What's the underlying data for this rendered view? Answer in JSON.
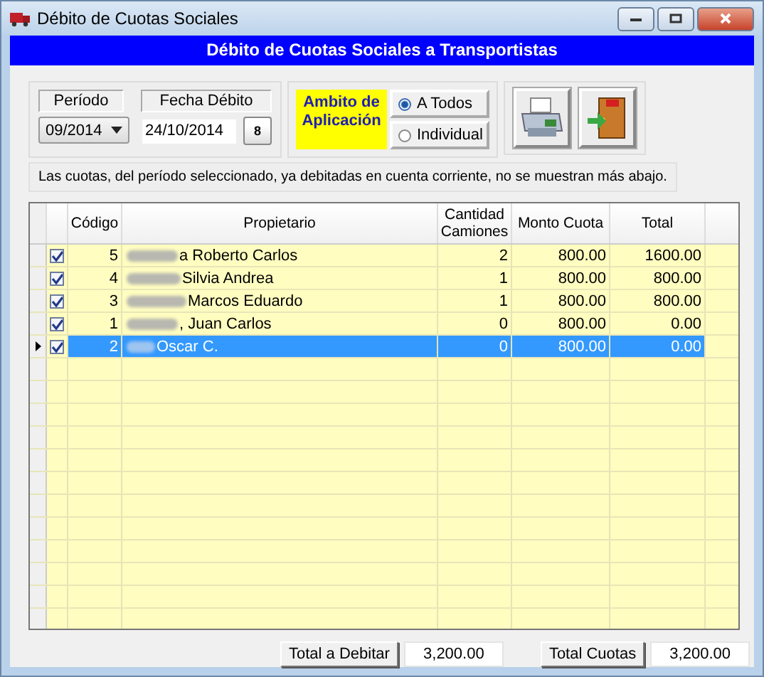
{
  "window": {
    "title": "Débito de Cuotas Sociales"
  },
  "banner": "Débito de Cuotas Sociales a Transportistas",
  "periodo": {
    "label": "Período",
    "value": "09/2014"
  },
  "fecha": {
    "label": "Fecha Débito",
    "value": "24/10/2014",
    "calendar_day": "8"
  },
  "ambito": {
    "label": "Ambito de Aplicación",
    "options": [
      {
        "label": "A Todos",
        "selected": true
      },
      {
        "label": "Individual",
        "selected": false
      }
    ]
  },
  "note": "Las cuotas, del período seleccionado, ya debitadas en cuenta corriente, no se muestran más abajo.",
  "table": {
    "columns": [
      "Código",
      "Propietario",
      "Cantidad Camiones",
      "Monto Cuota",
      "Total"
    ],
    "rows": [
      {
        "checked": true,
        "selected": false,
        "codigo": "5",
        "propietario": "a Roberto Carlos",
        "cantidad": "2",
        "monto": "800.00",
        "total": "1600.00"
      },
      {
        "checked": true,
        "selected": false,
        "codigo": "4",
        "propietario": "Silvia Andrea",
        "cantidad": "1",
        "monto": "800.00",
        "total": "800.00"
      },
      {
        "checked": true,
        "selected": false,
        "codigo": "3",
        "propietario": "Marcos Eduardo",
        "cantidad": "1",
        "monto": "800.00",
        "total": "800.00"
      },
      {
        "checked": true,
        "selected": false,
        "codigo": "1",
        "propietario": ", Juan Carlos",
        "cantidad": "0",
        "monto": "800.00",
        "total": "0.00"
      },
      {
        "checked": true,
        "selected": true,
        "codigo": "2",
        "propietario": "Oscar C.",
        "cantidad": "0",
        "monto": "800.00",
        "total": "0.00"
      }
    ]
  },
  "footer": {
    "total_debitar": {
      "label": "Total a Debitar",
      "value": "3,200.00"
    },
    "total_cuotas": {
      "label": "Total Cuotas",
      "value": "3,200.00"
    }
  }
}
